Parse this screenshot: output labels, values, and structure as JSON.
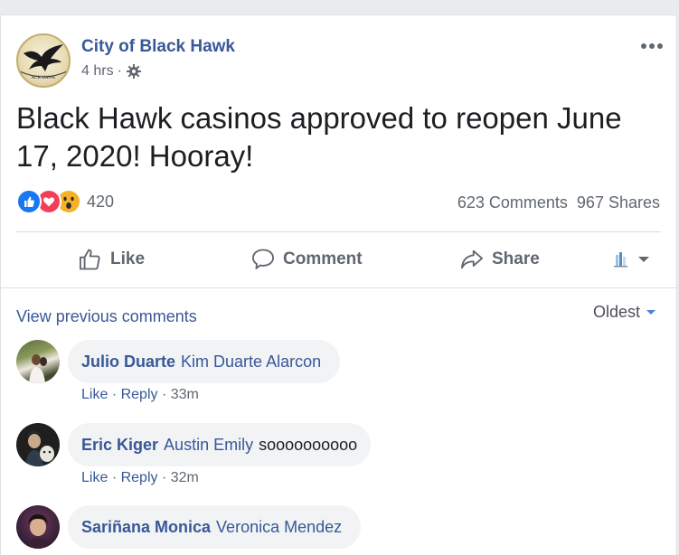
{
  "post": {
    "page_name": "City of Black Hawk",
    "time": "4 hrs",
    "separator": "·",
    "text": "Black Hawk casinos approved to reopen June 17, 2020! Hooray!",
    "reaction_count": "420",
    "comments_count": "623 Comments",
    "shares_count": "967 Shares",
    "logo_text": "ACK HAWK"
  },
  "actions": {
    "like": "Like",
    "comment": "Comment",
    "share": "Share"
  },
  "comments_section": {
    "view_previous": "View previous comments",
    "sort": "Oldest"
  },
  "comments": [
    {
      "author": "Julio Duarte",
      "tag": "Kim Duarte Alarcon",
      "text": "",
      "like": "Like",
      "reply": "Reply",
      "time": "33m",
      "dot": "·"
    },
    {
      "author": "Eric Kiger",
      "tag": "Austin Emily",
      "text": "soooooooooo",
      "like": "Like",
      "reply": "Reply",
      "time": "32m",
      "dot": "·"
    },
    {
      "author": "Sariñana Monica",
      "tag": "Veronica Mendez",
      "text": ""
    }
  ],
  "colors": {
    "link": "#385898",
    "like_blue": "#1877f2",
    "love_red": "#f33e58",
    "wow_yellow": "#f7b125",
    "gray_text": "#606770"
  },
  "icons": [
    "eagle-logo",
    "gear-icon",
    "more-icon",
    "like-reaction-icon",
    "love-reaction-icon",
    "wow-reaction-icon",
    "thumbs-up-icon",
    "comment-icon",
    "share-icon",
    "page-avatar-icon",
    "caret-down-icon"
  ]
}
